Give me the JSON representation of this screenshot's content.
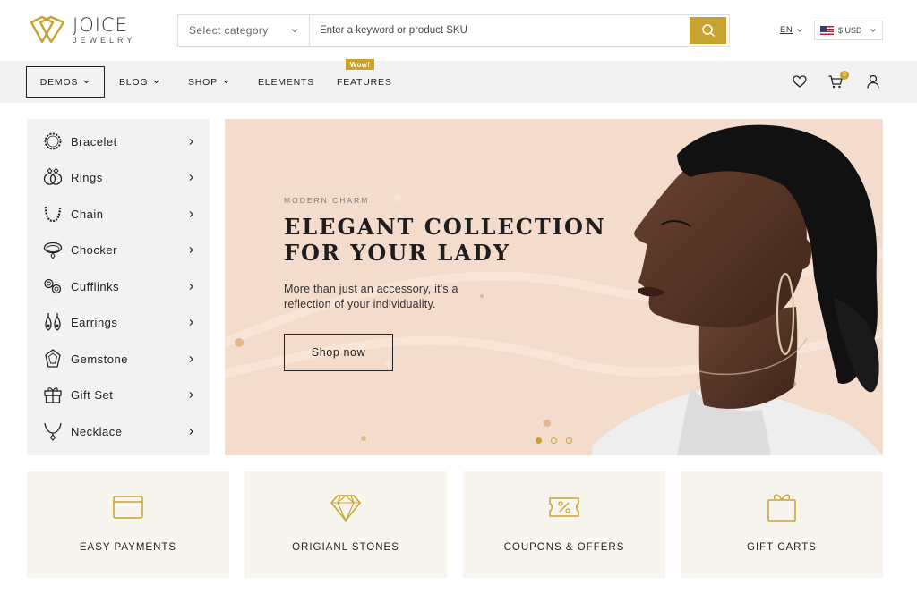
{
  "brand": {
    "name": "JOICE",
    "tagline": "JEWELRY",
    "accent": "#c9a32f"
  },
  "search": {
    "category": "Select category",
    "placeholder": "Enter a keyword or product SKU"
  },
  "header": {
    "language": "EN",
    "currency": "$ USD"
  },
  "nav": {
    "items": [
      {
        "label": "DEMOS",
        "dropdown": true
      },
      {
        "label": "BLOG",
        "dropdown": true
      },
      {
        "label": "SHOP",
        "dropdown": true
      },
      {
        "label": "ELEMENTS",
        "dropdown": false
      },
      {
        "label": "FEATURES",
        "dropdown": false
      }
    ],
    "badge": "Wow!",
    "cart_count": "0"
  },
  "sidebar": {
    "items": [
      {
        "label": "Bracelet",
        "icon": "bracelet-icon"
      },
      {
        "label": "Rings",
        "icon": "rings-icon"
      },
      {
        "label": "Chain",
        "icon": "chain-icon"
      },
      {
        "label": "Chocker",
        "icon": "choker-icon"
      },
      {
        "label": "Cufflinks",
        "icon": "cufflinks-icon"
      },
      {
        "label": "Earrings",
        "icon": "earrings-icon"
      },
      {
        "label": "Gemstone",
        "icon": "gemstone-icon"
      },
      {
        "label": "Gift Set",
        "icon": "gift-set-icon"
      },
      {
        "label": "Necklace",
        "icon": "necklace-icon"
      }
    ]
  },
  "hero": {
    "eyebrow": "MODERN CHARM",
    "title_line1": "ELEGANT COLLECTION",
    "title_line2": "FOR YOUR LADY",
    "description": "More than just an accessory, it's a reflection of your individuality.",
    "button": "Shop now",
    "slides": 3,
    "active_slide": 1
  },
  "features": [
    {
      "label": "EASY PAYMENTS",
      "icon": "credit-card-icon"
    },
    {
      "label": "ORIGIANL STONES",
      "icon": "diamond-icon"
    },
    {
      "label": "COUPONS & OFFERS",
      "icon": "coupon-icon"
    },
    {
      "label": "GIFT CARTS",
      "icon": "gift-box-icon"
    }
  ]
}
